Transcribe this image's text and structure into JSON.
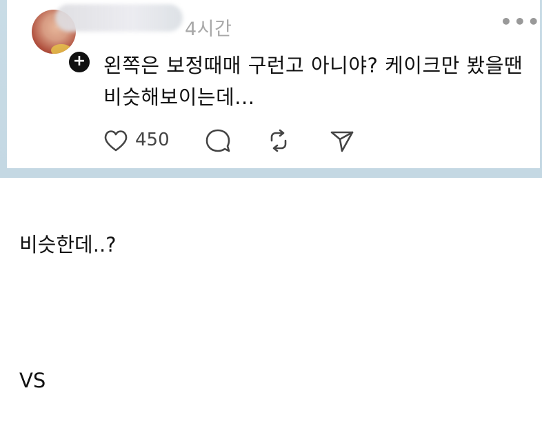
{
  "post": {
    "time": "4시간",
    "more_label": "•••",
    "plus_label": "+",
    "text_line1": "왼쪽은 보정때매 구런고 아니야?  케이크만 봤을땐",
    "text_line2": "비슷해보이는데...",
    "like_count": "450",
    "icons": [
      "heart-icon",
      "reply-icon",
      "repost-icon",
      "share-icon"
    ]
  },
  "caption": {
    "line1": "비슷한데..?",
    "line2": "VS"
  }
}
